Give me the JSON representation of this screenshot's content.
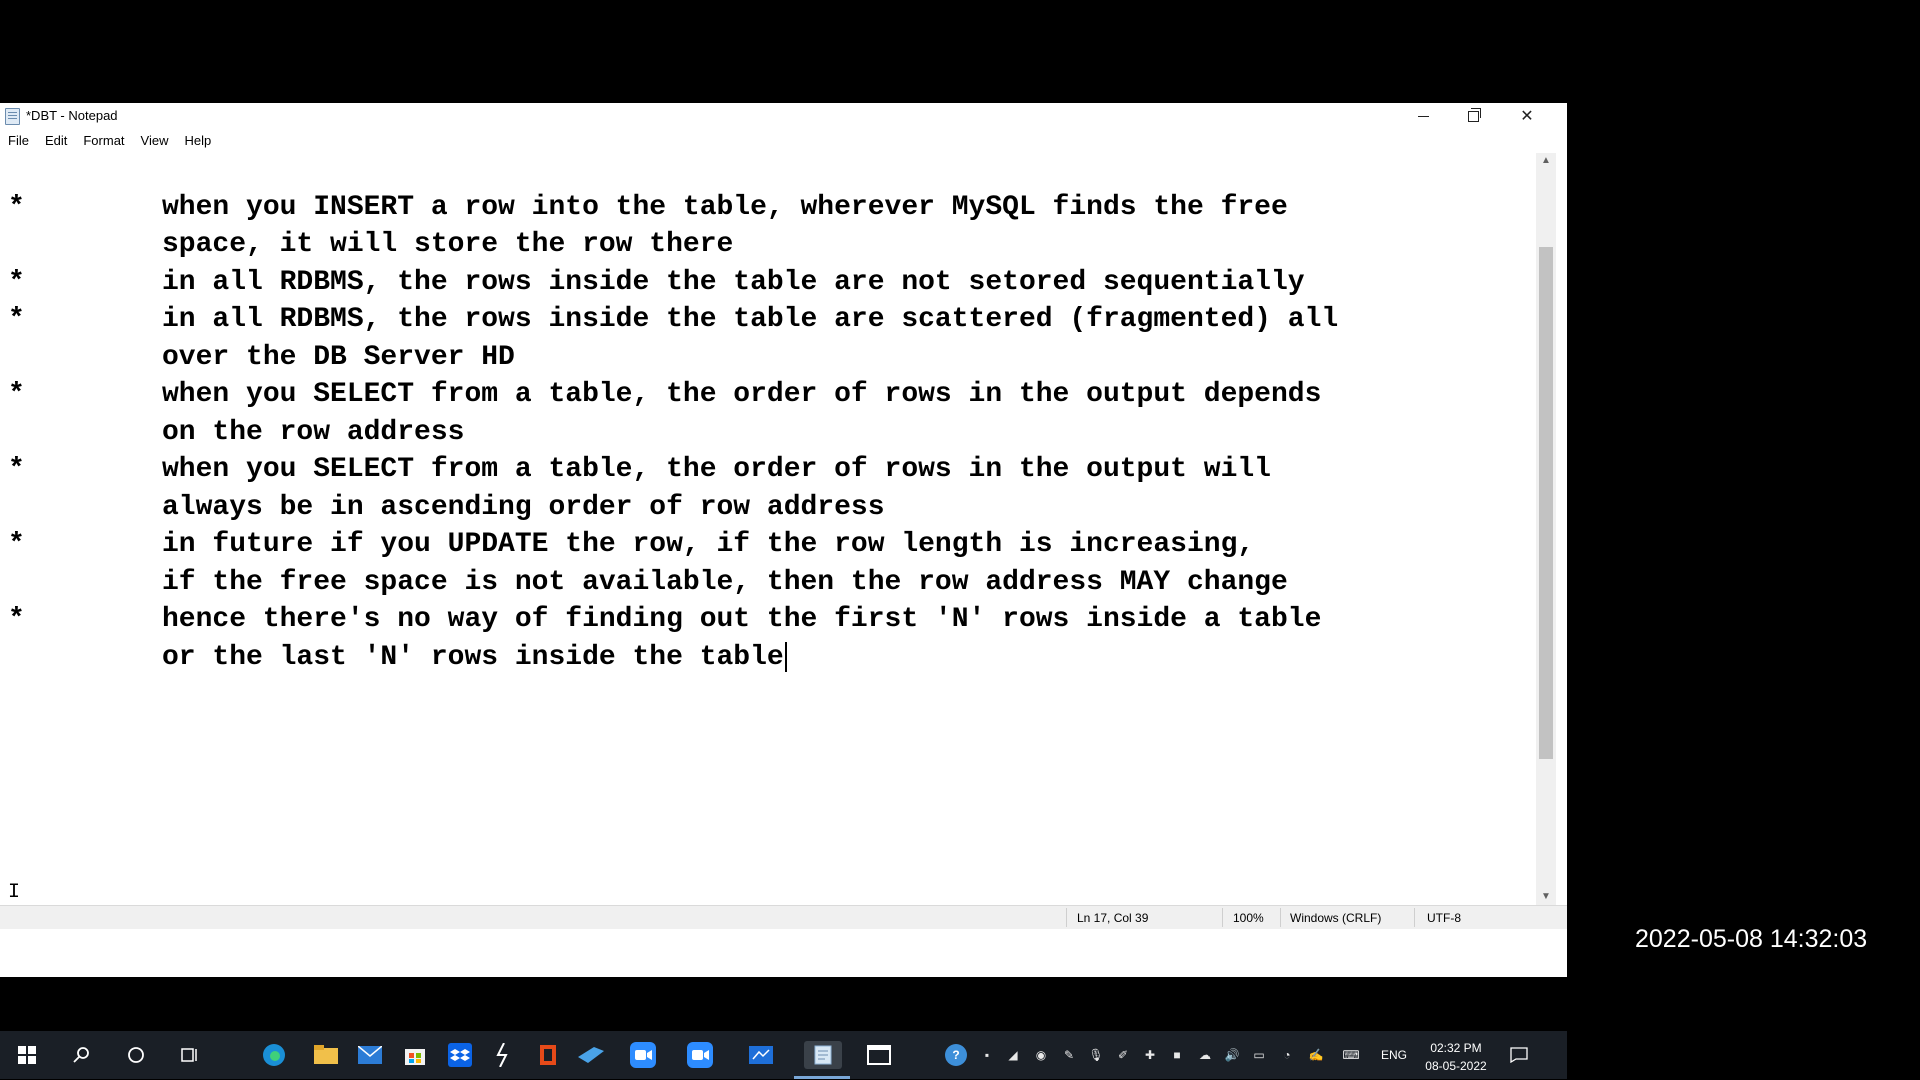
{
  "window": {
    "title": "*DBT - Notepad",
    "buttons": {
      "minimize": "—",
      "maximize": "❐",
      "close": "✕"
    }
  },
  "menu": [
    {
      "label": "File"
    },
    {
      "label": "Edit"
    },
    {
      "label": "Format"
    },
    {
      "label": "View"
    },
    {
      "label": "Help"
    }
  ],
  "editor": {
    "lines": [
      {
        "bullet": "*",
        "text": "when you INSERT a row into the table, wherever MySQL finds the free"
      },
      {
        "bullet": "",
        "text": "space, it will store the row there"
      },
      {
        "bullet": "*",
        "text": "in all RDBMS, the rows inside the table are not setored sequentially"
      },
      {
        "bullet": "*",
        "text": "in all RDBMS, the rows inside the table are scattered (fragmented) all"
      },
      {
        "bullet": "",
        "text": "over the DB Server HD"
      },
      {
        "bullet": "*",
        "text": "when you SELECT from a table, the order of rows in the output depends"
      },
      {
        "bullet": "",
        "text": "on the row address"
      },
      {
        "bullet": "*",
        "text": "when you SELECT from a table, the order of rows in the output will"
      },
      {
        "bullet": "",
        "text": "always be in ascending order of row address"
      },
      {
        "bullet": "*",
        "text": "in future if you UPDATE the row, if the row length is increasing,"
      },
      {
        "bullet": "",
        "text": "if the free space is not available, then the row address MAY change"
      },
      {
        "bullet": "*",
        "text": "hence there's no way of finding out the first 'N' rows inside a table"
      },
      {
        "bullet": "",
        "text": "or the last 'N' rows inside the table"
      }
    ]
  },
  "status": {
    "position": "Ln 17, Col 39",
    "zoom": "100%",
    "line_endings": "Windows (CRLF)",
    "encoding": "UTF-8"
  },
  "taskbar": {
    "icons": [
      "windows-start-icon",
      "search-icon",
      "cortana-icon",
      "task-view-icon",
      "edge-icon",
      "file-explorer-icon",
      "mail-icon",
      "store-icon",
      "dropbox-icon",
      "app-icon",
      "office-icon",
      "azure-data-icon",
      "zoom-icon",
      "zoom-meeting-icon",
      "whiteboard-icon",
      "notepad-icon",
      "terminal-icon"
    ],
    "tray": {
      "language": "ENG"
    },
    "clock": {
      "time": "02:32 PM",
      "date": "08-05-2022"
    }
  },
  "overlay": {
    "timestamp": "2022-05-08 14:32:03"
  },
  "colors": {
    "taskbar": "#1a1f26",
    "accent": "#7aa8d8",
    "editor_bg": "#ffffff"
  }
}
